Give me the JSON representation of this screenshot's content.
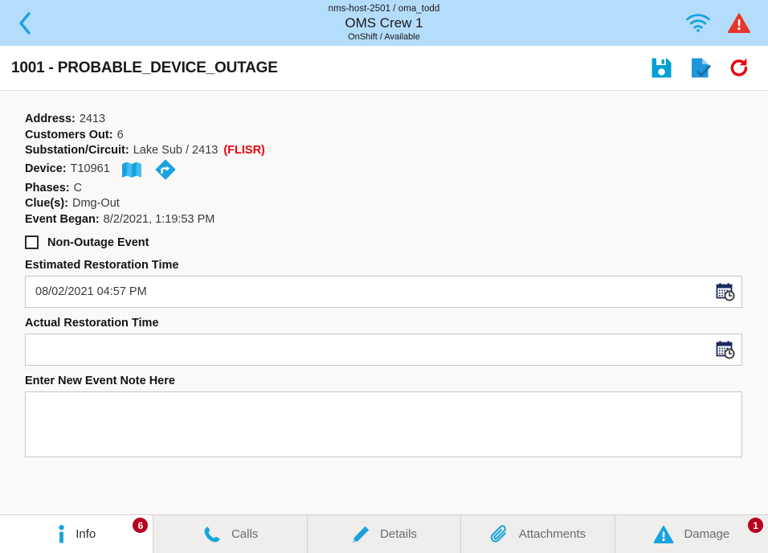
{
  "header": {
    "back_icon": "chevron-left-icon",
    "host_user": "nms-host-2501 / oma_todd",
    "crew_name": "OMS Crew 1",
    "crew_status": "OnShift / Available",
    "wifi_icon": "wifi-icon",
    "alert_icon": "warning-triangle-icon",
    "accent_color": "#19a3dd",
    "background_color": "#b4dcfb",
    "alert_color": "#e8000d"
  },
  "titlebar": {
    "title": "1001 - PROBABLE_DEVICE_OUTAGE",
    "actions": [
      {
        "name": "save-button",
        "icon": "save-floppy-icon",
        "color": "#00a0d2"
      },
      {
        "name": "document-check-button",
        "icon": "document-check-icon",
        "color": "#2196d9"
      },
      {
        "name": "refresh-button",
        "icon": "refresh-redo-icon",
        "color": "#e8000d"
      }
    ]
  },
  "details": {
    "address_label": "Address:",
    "address_value": "2413",
    "customers_out_label": "Customers Out:",
    "customers_out_value": "6",
    "substation_label": "Substation/Circuit:",
    "substation_value": "Lake Sub / 2413",
    "substation_flag": "(FLISR)",
    "device_label": "Device:",
    "device_value": "T10961",
    "device_map_icon": "map-icon",
    "device_directions_icon": "directions-diamond-icon",
    "phases_label": "Phases:",
    "phases_value": "C",
    "clues_label": "Clue(s):",
    "clues_value": "Dmg-Out",
    "event_began_label": "Event Began:",
    "event_began_value": "8/2/2021, 1:19:53 PM"
  },
  "form": {
    "non_outage_label": "Non-Outage Event",
    "non_outage_checked": false,
    "est_restoration_label": "Estimated Restoration Time",
    "est_restoration_value": "08/02/2021 04:57 PM",
    "est_restoration_placeholder": "",
    "actual_restoration_label": "Actual Restoration Time",
    "actual_restoration_value": "",
    "actual_restoration_placeholder": "",
    "note_label": "Enter New Event Note Here",
    "note_value": "",
    "note_placeholder": "",
    "calendar_icon": "calendar-clock-icon"
  },
  "tabs": [
    {
      "label": "Info",
      "icon": "info-icon",
      "active": true,
      "badge": "6"
    },
    {
      "label": "Calls",
      "icon": "phone-icon",
      "active": false,
      "badge": ""
    },
    {
      "label": "Details",
      "icon": "pencil-icon",
      "active": false,
      "badge": ""
    },
    {
      "label": "Attachments",
      "icon": "paperclip-icon",
      "active": false,
      "badge": ""
    },
    {
      "label": "Damage",
      "icon": "warning-triangle-icon",
      "active": false,
      "badge": "1"
    }
  ]
}
